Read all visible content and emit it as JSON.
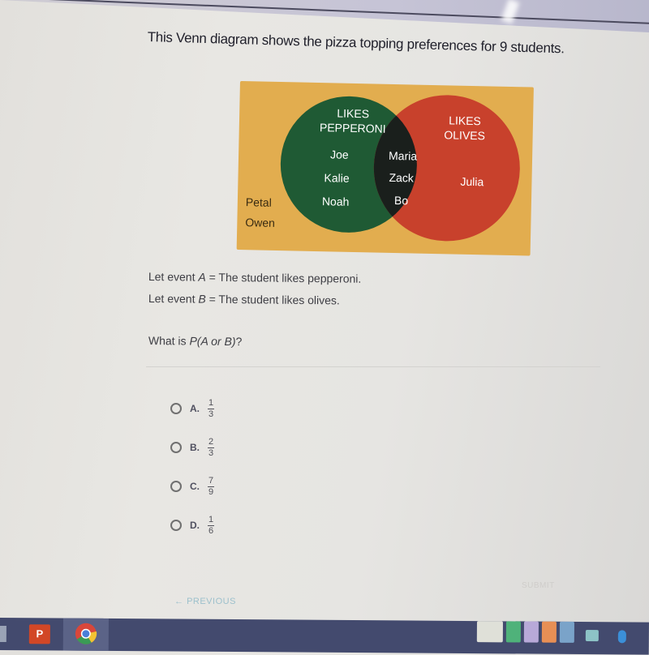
{
  "question": {
    "prompt": "This Venn diagram shows the pizza topping preferences for 9 students.",
    "event_a_line": [
      "Let event ",
      "A",
      " = The student likes pepperoni."
    ],
    "event_b_line": [
      "Let event ",
      "B",
      " = The student likes olives."
    ],
    "question_text": [
      "What is ",
      "P(A or B)",
      "?"
    ]
  },
  "venn": {
    "colors": {
      "background": "#e2ad4f",
      "set_a": "#1f5a34",
      "set_b": "#c8412c",
      "intersection": "#1a1f1c"
    },
    "set_a_label": [
      "LIKES",
      "PEPPERONI"
    ],
    "set_b_label": [
      "LIKES",
      "OLIVES"
    ],
    "only_a": [
      "Joe",
      "Kalie",
      "Noah"
    ],
    "both": [
      "Maria",
      "Zack",
      "Bo"
    ],
    "only_b": [
      "Julia"
    ],
    "neither": [
      "Petal",
      "Owen"
    ]
  },
  "options": [
    {
      "letter": "A.",
      "numerator": "1",
      "denominator": "3"
    },
    {
      "letter": "B.",
      "numerator": "2",
      "denominator": "3"
    },
    {
      "letter": "C.",
      "numerator": "7",
      "denominator": "9"
    },
    {
      "letter": "D.",
      "numerator": "1",
      "denominator": "6"
    }
  ],
  "nav": {
    "previous_label": "PREVIOUS",
    "previous_icon": "arrow-left-icon",
    "submit_label": "SUBMIT"
  },
  "taskbar": {
    "apps": [
      "file-explorer-icon",
      "powerpoint-icon",
      "chrome-icon"
    ],
    "tray": [
      "tray-thumbnail",
      "play-icon",
      "tray-app-purple",
      "tray-app-orange",
      "tray-app-blue",
      "eye-icon",
      "bluetooth-icon"
    ]
  }
}
